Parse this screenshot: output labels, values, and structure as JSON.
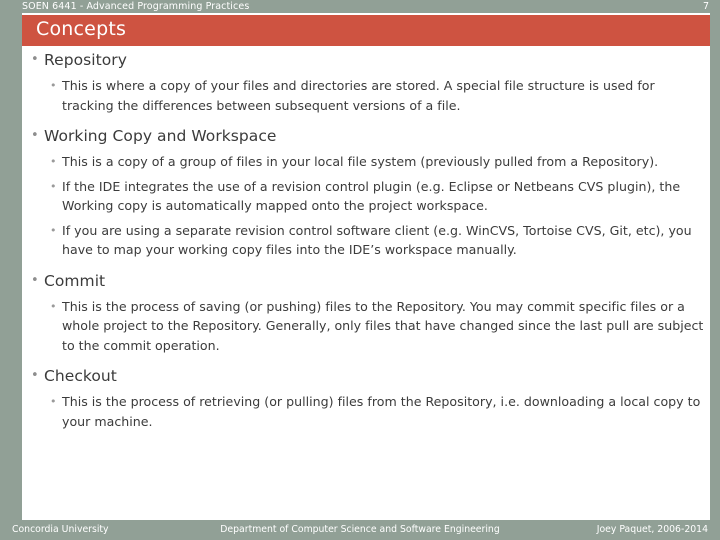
{
  "header": {
    "course_title": "SOEN 6441 - Advanced Programming Practices",
    "page_number": "7"
  },
  "title_banner": {
    "title": "Concepts"
  },
  "colors": {
    "banner": "#ce5341",
    "chrome": "#91a096",
    "body_text": "#3b3b3b",
    "bullet": "#8e8e8e",
    "background": "#ffffff"
  },
  "bullet_glyph": "•",
  "content": {
    "sections": [
      {
        "heading": "Repository",
        "points": [
          "This is where a copy of your files and directories are stored. A special file structure is used for tracking the differences between subsequent versions of a file."
        ]
      },
      {
        "heading": "Working Copy and Workspace",
        "points": [
          "This is a copy of a group of files in your local file system (previously pulled from a Repository).",
          "If the IDE integrates the use of a revision control plugin (e.g. Eclipse or Netbeans CVS plugin), the Working copy is automatically mapped onto the project workspace.",
          "If you are using a separate revision control software client (e.g. WinCVS, Tortoise CVS, Git, etc), you have to map your working copy files into the IDE’s workspace manually."
        ]
      },
      {
        "heading": "Commit",
        "points": [
          "This is the process of saving (or pushing) files to the Repository. You may commit specific files or a whole project to the Repository. Generally, only files that have changed since the last pull are subject to the commit operation."
        ]
      },
      {
        "heading": "Checkout",
        "points": [
          "This is the process of retrieving (or pulling) files from the Repository, i.e. downloading a local copy to your machine."
        ]
      }
    ]
  },
  "footer": {
    "left": "Concordia University",
    "center": "Department of Computer Science and Software Engineering",
    "right": "Joey Paquet, 2006-2014"
  }
}
